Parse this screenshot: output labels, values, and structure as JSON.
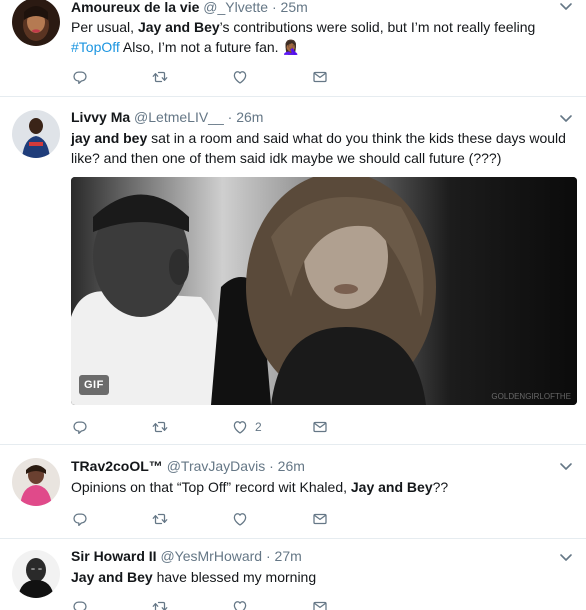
{
  "colors": {
    "link": "#1b95e0",
    "secondary_text": "#657786",
    "divider": "#e6ecf0"
  },
  "tweets": [
    {
      "display_name": "Amoureux de la vie",
      "handle": "@_Ylvette",
      "separator": "·",
      "time": "25m",
      "text_parts": {
        "p1": "Per usual, ",
        "b1": "Jay and  Bey",
        "p2": "’s contributions were solid, but I’m not really feeling",
        "hashtag": "#TopOff",
        "p3": " Also, I’m not a future fan. 🤦🏾‍♀️"
      },
      "actions": {
        "reply_count": "",
        "retweet_count": "",
        "like_count": ""
      }
    },
    {
      "display_name": "Livvy Ma",
      "handle": "@LetmeLIV__",
      "separator": "·",
      "time": "26m",
      "text_parts": {
        "b1": "jay and bey",
        "p1": " sat in a room and said what do you think the kids these days would like? and then one of them said idk maybe we should call future (???)"
      },
      "media": {
        "badge": "GIF",
        "watermark": "GOLDENGIRLOFTHE"
      },
      "actions": {
        "reply_count": "",
        "retweet_count": "",
        "like_count": "2"
      }
    },
    {
      "display_name": "TRav2coOL™",
      "handle": "@TravJayDavis",
      "separator": "·",
      "time": "26m",
      "text_parts": {
        "p1": "Opinions on that “Top Off” record wit Khaled, ",
        "b1": "Jay and Bey",
        "p2": "??"
      },
      "actions": {
        "reply_count": "",
        "retweet_count": "",
        "like_count": ""
      }
    },
    {
      "display_name": "Sir Howard II",
      "handle": "@YesMrHoward",
      "separator": "·",
      "time": "27m",
      "text_parts": {
        "b1": "Jay and Bey",
        "p1": " have blessed my morning"
      },
      "actions": {
        "reply_count": "",
        "retweet_count": "",
        "like_count": ""
      }
    }
  ],
  "icons": {
    "reply": "reply-icon",
    "retweet": "retweet-icon",
    "like": "heart-icon",
    "dm": "envelope-icon",
    "menu": "chevron-down-icon"
  }
}
